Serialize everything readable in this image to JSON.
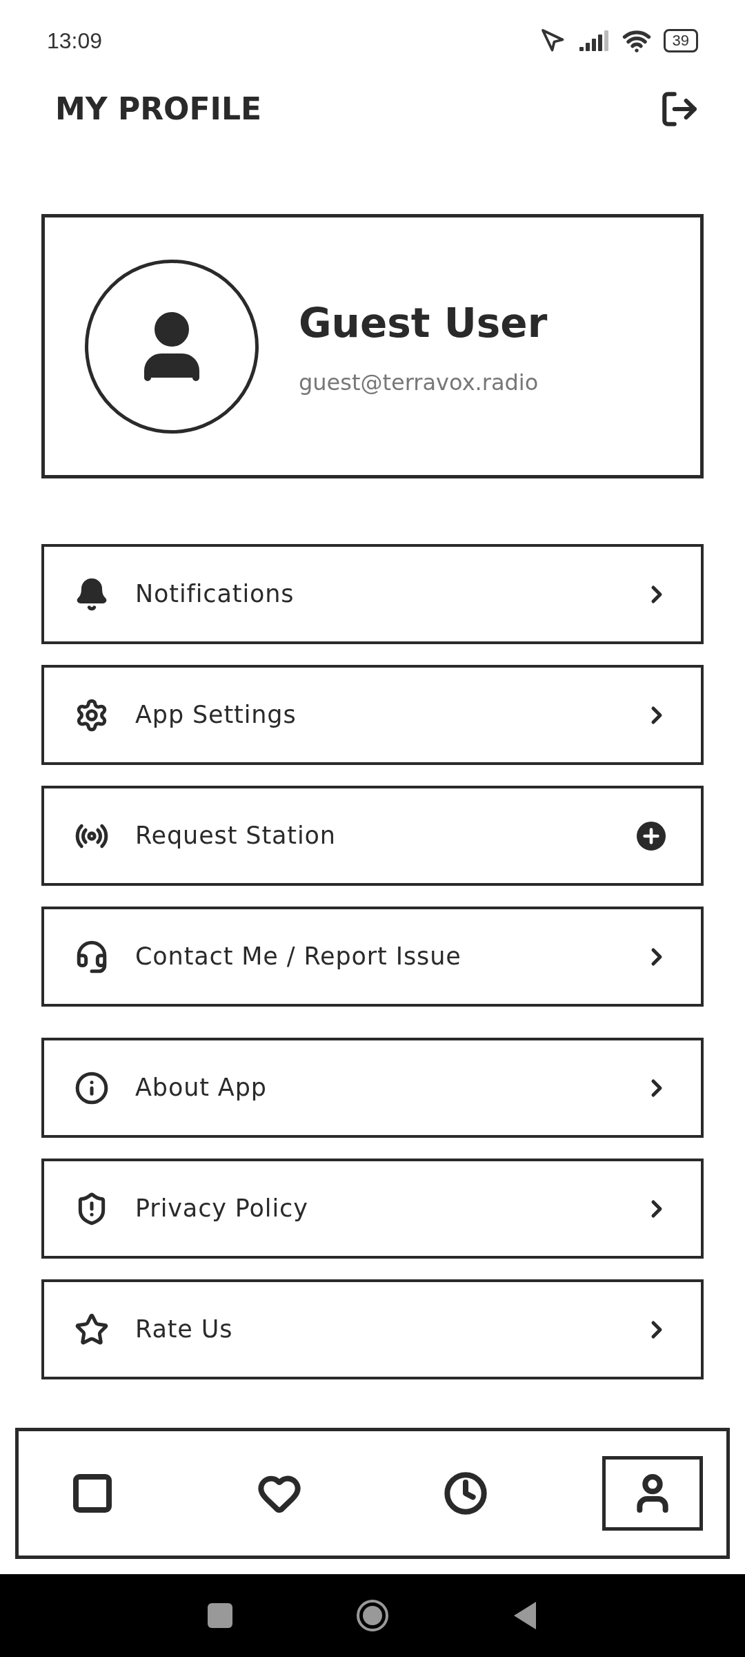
{
  "status_bar": {
    "time": "13:09",
    "battery": "39"
  },
  "header": {
    "title": "MY PROFILE"
  },
  "profile": {
    "name": "Guest User",
    "email": "guest@terravox.radio"
  },
  "menu_groups": [
    [
      {
        "label": "Notifications",
        "kind": "chevron"
      },
      {
        "label": "App Settings",
        "kind": "chevron"
      },
      {
        "label": "Request Station",
        "kind": "plus"
      },
      {
        "label": "Contact Me / Report Issue",
        "kind": "chevron"
      }
    ],
    [
      {
        "label": "About App",
        "kind": "chevron"
      },
      {
        "label": "Privacy Policy",
        "kind": "chevron"
      },
      {
        "label": "Rate Us",
        "kind": "chevron"
      }
    ]
  ],
  "bottom_nav": [
    {
      "selected": false
    },
    {
      "selected": false
    },
    {
      "selected": false
    },
    {
      "selected": true
    }
  ]
}
